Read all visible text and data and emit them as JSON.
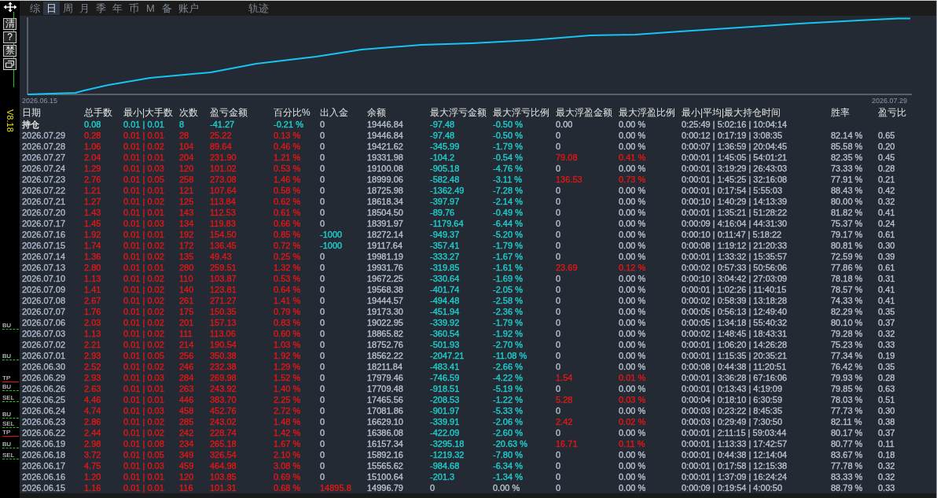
{
  "tabs": [
    {
      "label": "综",
      "selected": false
    },
    {
      "label": "日",
      "selected": true
    },
    {
      "label": "周",
      "selected": false
    },
    {
      "label": "月",
      "selected": false
    },
    {
      "label": "季",
      "selected": false
    },
    {
      "label": "年",
      "selected": false
    },
    {
      "label": "币",
      "selected": false
    },
    {
      "label": "M",
      "selected": false
    },
    {
      "label": "备",
      "selected": false
    },
    {
      "label": "账户",
      "selected": false
    }
  ],
  "track_tab": {
    "label": "轨迹",
    "selected": false
  },
  "toolbar": {
    "buttons": [
      "清",
      "?",
      "禁"
    ],
    "version": "V8.18"
  },
  "chart_markers": [
    {
      "label": "BU",
      "kind": "entry"
    },
    {
      "label": "BU",
      "kind": "entry"
    },
    {
      "label": "TP",
      "kind": "target"
    },
    {
      "label": "BU",
      "kind": "entry"
    },
    {
      "label": "SEL",
      "kind": "entry"
    },
    {
      "label": "BU",
      "kind": "entry"
    },
    {
      "label": "SEL",
      "kind": "entry"
    },
    {
      "label": "TP",
      "kind": "target"
    },
    {
      "label": "BU",
      "kind": "entry"
    },
    {
      "label": "SEL",
      "kind": "entry"
    }
  ],
  "chart": {
    "start_label": "2026.06.15",
    "end_label": "2026.07.29"
  },
  "table": {
    "columns": [
      "日期",
      "总手数",
      "最小|大手数",
      "次数",
      "盈亏金额",
      "百分比%",
      "出入金",
      "余额",
      "最大浮亏金额",
      "最大浮亏比例",
      "最大浮盈金额",
      "最大浮盈比例",
      "最小|平均|最大持仓时间",
      "胜率",
      "盈亏比"
    ],
    "rows": [
      {
        "kind": "holding",
        "date": "持仓",
        "trade": {
          "color": "#1fd0d0",
          "cells": [
            "0.08",
            "0.01 | 0.01",
            "8",
            "-41.27",
            "-0.21 %"
          ]
        },
        "cash": {
          "text": "0"
        },
        "balance": "19446.84",
        "float_loss": {
          "color": "#1fd0d0",
          "cells": [
            "-97.48",
            "-0.50 %"
          ]
        },
        "float_profit": {
          "cells": [
            "0.00",
            "0.00 %"
          ]
        },
        "hold_time": "0:25:49 | 5:02:16 | 10:04:14"
      },
      {
        "kind": "day",
        "date": "2026.07.29",
        "trade": {
          "color": "#e01818",
          "cells": [
            "0.28",
            "0.01 | 0.01",
            "28",
            "25.22",
            "0.13 %"
          ]
        },
        "cash": {
          "text": "0"
        },
        "balance": "19446.84",
        "float_loss": {
          "color": "#1fd0d0",
          "cells": [
            "-97.48",
            "-0.50 %"
          ]
        },
        "float_profit": {
          "cells": [
            "0",
            "0.00 %"
          ]
        },
        "hold_time": "0:00:12 | 0:17:19 | 3:08:35",
        "win_rate": "82.14 %",
        "profit_ratio": "0.65"
      },
      {
        "kind": "day",
        "date": "2026.07.28",
        "trade": {
          "color": "#e01818",
          "cells": [
            "1.06",
            "0.01 | 0.02",
            "104",
            "89.64",
            "0.46 %"
          ]
        },
        "cash": {
          "text": "0"
        },
        "balance": "19421.62",
        "float_loss": {
          "color": "#1fd0d0",
          "cells": [
            "-345.99",
            "-1.79 %"
          ]
        },
        "float_profit": {
          "cells": [
            "0",
            "0.00 %"
          ]
        },
        "hold_time": "0:00:07 | 1:36:59 | 20:04:45",
        "win_rate": "85.58 %",
        "profit_ratio": "0.20"
      },
      {
        "kind": "day",
        "date": "2026.07.27",
        "trade": {
          "color": "#e01818",
          "cells": [
            "2.04",
            "0.01 | 0.01",
            "204",
            "231.90",
            "1.21 %"
          ]
        },
        "cash": {
          "text": "0"
        },
        "balance": "19331.98",
        "float_loss": {
          "color": "#1fd0d0",
          "cells": [
            "-104.2",
            "-0.54 %"
          ]
        },
        "float_profit": {
          "color": "#e01818",
          "cells": [
            "79.08",
            "0.41 %"
          ]
        },
        "hold_time": "0:00:01 | 1:45:05 | 54:01:21",
        "win_rate": "82.35 %",
        "profit_ratio": "0.45"
      },
      {
        "kind": "day",
        "date": "2026.07.24",
        "trade": {
          "color": "#e01818",
          "cells": [
            "1.29",
            "0.01 | 0.03",
            "120",
            "101.02",
            "0.53 %"
          ]
        },
        "cash": {
          "text": "0"
        },
        "balance": "19100.08",
        "float_loss": {
          "color": "#1fd0d0",
          "cells": [
            "-905.18",
            "-4.76 %"
          ]
        },
        "float_profit": {
          "cells": [
            "0",
            "0.00 %"
          ]
        },
        "hold_time": "0:00:01 | 3:19:29 | 26:43:03",
        "win_rate": "73.33 %",
        "profit_ratio": "0.28"
      },
      {
        "kind": "day",
        "date": "2026.07.23",
        "trade": {
          "color": "#e01818",
          "cells": [
            "2.76",
            "0.01 | 0.05",
            "258",
            "273.08",
            "1.46 %"
          ]
        },
        "cash": {
          "text": "0"
        },
        "balance": "18999.06",
        "float_loss": {
          "color": "#1fd0d0",
          "cells": [
            "-582.48",
            "-3.11 %"
          ]
        },
        "float_profit": {
          "color": "#e01818",
          "cells": [
            "136.53",
            "0.73 %"
          ]
        },
        "hold_time": "0:00:01 | 1:45:25 | 32:16:08",
        "win_rate": "77.91 %",
        "profit_ratio": "0.21"
      },
      {
        "kind": "day",
        "date": "2026.07.22",
        "trade": {
          "color": "#e01818",
          "cells": [
            "1.21",
            "0.01 | 0.01",
            "121",
            "107.64",
            "0.58 %"
          ]
        },
        "cash": {
          "text": "0"
        },
        "balance": "18725.98",
        "float_loss": {
          "color": "#1fd0d0",
          "cells": [
            "-1362.49",
            "-7.28 %"
          ]
        },
        "float_profit": {
          "cells": [
            "0",
            "0.00 %"
          ]
        },
        "hold_time": "0:00:01 | 0:17:54 | 5:55:03",
        "win_rate": "88.43 %",
        "profit_ratio": "0.42"
      },
      {
        "kind": "day",
        "date": "2026.07.21",
        "trade": {
          "color": "#e01818",
          "cells": [
            "1.27",
            "0.01 | 0.02",
            "125",
            "113.84",
            "0.62 %"
          ]
        },
        "cash": {
          "text": "0"
        },
        "balance": "18618.34",
        "float_loss": {
          "color": "#1fd0d0",
          "cells": [
            "-397.97",
            "-2.14 %"
          ]
        },
        "float_profit": {
          "cells": [
            "0",
            "0.00 %"
          ]
        },
        "hold_time": "0:00:10 | 1:40:29 | 14:13:39",
        "win_rate": "80.00 %",
        "profit_ratio": "0.32"
      },
      {
        "kind": "day",
        "date": "2026.07.20",
        "trade": {
          "color": "#e01818",
          "cells": [
            "1.43",
            "0.01 | 0.01",
            "143",
            "112.53",
            "0.61 %"
          ]
        },
        "cash": {
          "text": "0"
        },
        "balance": "18504.50",
        "float_loss": {
          "color": "#1fd0d0",
          "cells": [
            "-89.76",
            "-0.49 %"
          ]
        },
        "float_profit": {
          "cells": [
            "0",
            "0.00 %"
          ]
        },
        "hold_time": "0:00:01 | 1:35:21 | 51:28:22",
        "win_rate": "81.82 %",
        "profit_ratio": "0.41"
      },
      {
        "kind": "day",
        "date": "2026.07.17",
        "trade": {
          "color": "#e01818",
          "cells": [
            "1.45",
            "0.01 | 0.03",
            "134",
            "119.83",
            "0.66 %"
          ]
        },
        "cash": {
          "text": "0"
        },
        "balance": "18391.97",
        "float_loss": {
          "color": "#1fd0d0",
          "cells": [
            "-1179.64",
            "-6.44 %"
          ]
        },
        "float_profit": {
          "cells": [
            "0",
            "0.00 %"
          ]
        },
        "hold_time": "0:00:09 | 4:16:04 | 44:31:30",
        "win_rate": "75.37 %",
        "profit_ratio": "0.24"
      },
      {
        "kind": "day",
        "date": "2026.07.16",
        "trade": {
          "color": "#e01818",
          "cells": [
            "1.92",
            "0.01 | 0.01",
            "192",
            "154.50",
            "0.85 %"
          ]
        },
        "cash": {
          "text": "-1000",
          "color": "#1fd0d0"
        },
        "balance": "18272.14",
        "float_loss": {
          "color": "#1fd0d0",
          "cells": [
            "-949.37",
            "-5.20 %"
          ]
        },
        "float_profit": {
          "cells": [
            "0",
            "0.00 %"
          ]
        },
        "hold_time": "0:00:10 | 0:11:47 | 5:18:22",
        "win_rate": "79.17 %",
        "profit_ratio": "0.61"
      },
      {
        "kind": "day",
        "date": "2026.07.15",
        "trade": {
          "color": "#e01818",
          "cells": [
            "1.74",
            "0.01 | 0.02",
            "172",
            "136.45",
            "0.72 %"
          ]
        },
        "cash": {
          "text": "-1000",
          "color": "#1fd0d0"
        },
        "balance": "19117.64",
        "float_loss": {
          "color": "#1fd0d0",
          "cells": [
            "-357.41",
            "-1.79 %"
          ]
        },
        "float_profit": {
          "cells": [
            "0",
            "0.00 %"
          ]
        },
        "hold_time": "0:00:08 | 1:19:12 | 21:20:33",
        "win_rate": "80.81 %",
        "profit_ratio": "0.30"
      },
      {
        "kind": "day",
        "date": "2026.07.14",
        "trade": {
          "color": "#e01818",
          "cells": [
            "1.36",
            "0.01 | 0.02",
            "135",
            "49.43",
            "0.25 %"
          ]
        },
        "cash": {
          "text": "0"
        },
        "balance": "19981.19",
        "float_loss": {
          "color": "#1fd0d0",
          "cells": [
            "-333.27",
            "-1.67 %"
          ]
        },
        "float_profit": {
          "cells": [
            "0",
            "0.00 %"
          ]
        },
        "hold_time": "0:00:01 | 1:33:32 | 15:35:57",
        "win_rate": "72.59 %",
        "profit_ratio": "0.39"
      },
      {
        "kind": "day",
        "date": "2026.07.13",
        "trade": {
          "color": "#e01818",
          "cells": [
            "2.80",
            "0.01 | 0.01",
            "280",
            "259.51",
            "1.32 %"
          ]
        },
        "cash": {
          "text": "0"
        },
        "balance": "19931.76",
        "float_loss": {
          "color": "#1fd0d0",
          "cells": [
            "-319.85",
            "-1.61 %"
          ]
        },
        "float_profit": {
          "color": "#e01818",
          "cells": [
            "23.69",
            "0.12 %"
          ]
        },
        "hold_time": "0:00:02 | 0:57:33 | 50:56:06",
        "win_rate": "77.86 %",
        "profit_ratio": "0.61"
      },
      {
        "kind": "day",
        "date": "2026.07.10",
        "trade": {
          "color": "#e01818",
          "cells": [
            "1.13",
            "0.01 | 0.02",
            "110",
            "103.87",
            "0.53 %"
          ]
        },
        "cash": {
          "text": "0"
        },
        "balance": "19672.25",
        "float_loss": {
          "color": "#1fd0d0",
          "cells": [
            "-330.64",
            "-1.69 %"
          ]
        },
        "float_profit": {
          "cells": [
            "0",
            "0.00 %"
          ]
        },
        "hold_time": "0:00:10 | 3:04:42 | 27:03:09",
        "win_rate": "78.18 %",
        "profit_ratio": "0.31"
      },
      {
        "kind": "day",
        "date": "2026.07.09",
        "trade": {
          "color": "#e01818",
          "cells": [
            "1.41",
            "0.01 | 0.02",
            "140",
            "123.81",
            "0.64 %"
          ]
        },
        "cash": {
          "text": "0"
        },
        "balance": "19568.38",
        "float_loss": {
          "color": "#1fd0d0",
          "cells": [
            "-401.74",
            "-2.05 %"
          ]
        },
        "float_profit": {
          "cells": [
            "0",
            "0.00 %"
          ]
        },
        "hold_time": "0:00:01 | 1:02:26 | 11:40:15",
        "win_rate": "78.57 %",
        "profit_ratio": "0.41"
      },
      {
        "kind": "day",
        "date": "2026.07.08",
        "trade": {
          "color": "#e01818",
          "cells": [
            "2.67",
            "0.01 | 0.02",
            "261",
            "271.27",
            "1.41 %"
          ]
        },
        "cash": {
          "text": "0"
        },
        "balance": "19444.57",
        "float_loss": {
          "color": "#1fd0d0",
          "cells": [
            "-494.48",
            "-2.58 %"
          ]
        },
        "float_profit": {
          "cells": [
            "0",
            "0.00 %"
          ]
        },
        "hold_time": "0:00:02 | 0:58:39 | 13:18:28",
        "win_rate": "74.33 %",
        "profit_ratio": "0.41"
      },
      {
        "kind": "day",
        "date": "2026.07.07",
        "trade": {
          "color": "#e01818",
          "cells": [
            "1.76",
            "0.01 | 0.02",
            "175",
            "150.35",
            "0.79 %"
          ]
        },
        "cash": {
          "text": "0"
        },
        "balance": "19173.30",
        "float_loss": {
          "color": "#1fd0d0",
          "cells": [
            "-451.94",
            "-2.36 %"
          ]
        },
        "float_profit": {
          "cells": [
            "0",
            "0.00 %"
          ]
        },
        "hold_time": "0:00:05 | 0:56:13 | 12:49:40",
        "win_rate": "82.29 %",
        "profit_ratio": "0.35"
      },
      {
        "kind": "day",
        "date": "2026.07.06",
        "trade": {
          "color": "#e01818",
          "cells": [
            "2.03",
            "0.01 | 0.02",
            "201",
            "157.13",
            "0.83 %"
          ]
        },
        "cash": {
          "text": "0"
        },
        "balance": "19022.95",
        "float_loss": {
          "color": "#1fd0d0",
          "cells": [
            "-339.92",
            "-1.79 %"
          ]
        },
        "float_profit": {
          "cells": [
            "0",
            "0.00 %"
          ]
        },
        "hold_time": "0:00:05 | 1:34:18 | 55:40:32",
        "win_rate": "80.10 %",
        "profit_ratio": "0.37"
      },
      {
        "kind": "day",
        "date": "2026.07.03",
        "trade": {
          "color": "#e01818",
          "cells": [
            "1.13",
            "0.01 | 0.02",
            "111",
            "113.06",
            "0.60 %"
          ]
        },
        "cash": {
          "text": "0"
        },
        "balance": "18865.82",
        "float_loss": {
          "color": "#1fd0d0",
          "cells": [
            "-360.54",
            "-1.92 %"
          ]
        },
        "float_profit": {
          "cells": [
            "0",
            "0.00 %"
          ]
        },
        "hold_time": "0:00:02 | 1:48:45 | 18:43:31",
        "win_rate": "79.28 %",
        "profit_ratio": "0.32"
      },
      {
        "kind": "day",
        "date": "2026.07.02",
        "trade": {
          "color": "#e01818",
          "cells": [
            "2.21",
            "0.01 | 0.02",
            "214",
            "190.54",
            "1.03 %"
          ]
        },
        "cash": {
          "text": "0"
        },
        "balance": "18752.76",
        "float_loss": {
          "color": "#1fd0d0",
          "cells": [
            "-501.93",
            "-2.70 %"
          ]
        },
        "float_profit": {
          "cells": [
            "0",
            "0.00 %"
          ]
        },
        "hold_time": "0:00:01 | 1:06:20 | 14:26:28",
        "win_rate": "75.23 %",
        "profit_ratio": "0.33"
      },
      {
        "kind": "day",
        "date": "2026.07.01",
        "trade": {
          "color": "#e01818",
          "cells": [
            "2.93",
            "0.01 | 0.05",
            "256",
            "350.38",
            "1.92 %"
          ]
        },
        "cash": {
          "text": "0"
        },
        "balance": "18562.22",
        "float_loss": {
          "color": "#1fd0d0",
          "cells": [
            "-2047.21",
            "-11.08 %"
          ]
        },
        "float_profit": {
          "cells": [
            "0",
            "0.00 %"
          ]
        },
        "hold_time": "0:00:01 | 1:15:35 | 20:35:21",
        "win_rate": "77.34 %",
        "profit_ratio": "0.19"
      },
      {
        "kind": "day",
        "date": "2026.06.30",
        "trade": {
          "color": "#e01818",
          "cells": [
            "2.52",
            "0.01 | 0.02",
            "246",
            "232.38",
            "1.29 %"
          ]
        },
        "cash": {
          "text": "0"
        },
        "balance": "18211.84",
        "float_loss": {
          "color": "#1fd0d0",
          "cells": [
            "-483.41",
            "-2.66 %"
          ]
        },
        "float_profit": {
          "cells": [
            "0",
            "0.00 %"
          ]
        },
        "hold_time": "0:00:08 | 0:44:38 | 11:20:51",
        "win_rate": "76.42 %",
        "profit_ratio": "0.35"
      },
      {
        "kind": "day",
        "date": "2026.06.29",
        "trade": {
          "color": "#e01818",
          "cells": [
            "2.93",
            "0.01 | 0.03",
            "284",
            "269.98",
            "1.52 %"
          ]
        },
        "cash": {
          "text": "0"
        },
        "balance": "17979.46",
        "float_loss": {
          "color": "#1fd0d0",
          "cells": [
            "-746.59",
            "-4.22 %"
          ]
        },
        "float_profit": {
          "color": "#e01818",
          "cells": [
            "1.54",
            "0.01 %"
          ]
        },
        "hold_time": "0:00:01 | 3:36:28 | 67:16:06",
        "win_rate": "79.93 %",
        "profit_ratio": "0.28"
      },
      {
        "kind": "day",
        "date": "2026.06.26",
        "trade": {
          "color": "#e01818",
          "cells": [
            "2.63",
            "0.01 | 0.01",
            "263",
            "243.92",
            "1.40 %"
          ]
        },
        "cash": {
          "text": "0"
        },
        "balance": "17709.48",
        "float_loss": {
          "color": "#1fd0d0",
          "cells": [
            "-918.51",
            "-5.19 %"
          ]
        },
        "float_profit": {
          "cells": [
            "0",
            "0.00 %"
          ]
        },
        "hold_time": "0:00:01 | 0:13:43 | 4:19:09",
        "win_rate": "79.85 %",
        "profit_ratio": "0.63"
      },
      {
        "kind": "day",
        "date": "2026.06.25",
        "trade": {
          "color": "#e01818",
          "cells": [
            "4.46",
            "0.01 | 0.01",
            "446",
            "383.70",
            "2.25 %"
          ]
        },
        "cash": {
          "text": "0"
        },
        "balance": "17465.56",
        "float_loss": {
          "color": "#1fd0d0",
          "cells": [
            "-208.53",
            "-1.22 %"
          ]
        },
        "float_profit": {
          "color": "#e01818",
          "cells": [
            "5.28",
            "0.03 %"
          ]
        },
        "hold_time": "0:00:04 | 0:18:10 | 6:30:59",
        "win_rate": "78.03 %",
        "profit_ratio": "0.51"
      },
      {
        "kind": "day",
        "date": "2026.06.24",
        "trade": {
          "color": "#e01818",
          "cells": [
            "4.74",
            "0.01 | 0.03",
            "458",
            "452.76",
            "2.72 %"
          ]
        },
        "cash": {
          "text": "0"
        },
        "balance": "17081.86",
        "float_loss": {
          "color": "#1fd0d0",
          "cells": [
            "-901.97",
            "-5.33 %"
          ]
        },
        "float_profit": {
          "cells": [
            "0",
            "0.00 %"
          ]
        },
        "hold_time": "0:00:03 | 0:23:22 | 8:45:35",
        "win_rate": "77.73 %",
        "profit_ratio": "0.30"
      },
      {
        "kind": "day",
        "date": "2026.06.23",
        "trade": {
          "color": "#e01818",
          "cells": [
            "2.86",
            "0.01 | 0.02",
            "285",
            "243.02",
            "1.48 %"
          ]
        },
        "cash": {
          "text": "0"
        },
        "balance": "16629.10",
        "float_loss": {
          "color": "#1fd0d0",
          "cells": [
            "-339.91",
            "-2.06 %"
          ]
        },
        "float_profit": {
          "color": "#e01818",
          "cells": [
            "2.42",
            "0.02 %"
          ]
        },
        "hold_time": "0:00:03 | 0:29:49 | 7:30:50",
        "win_rate": "82.11 %",
        "profit_ratio": "0.38"
      },
      {
        "kind": "day",
        "date": "2026.06.22",
        "trade": {
          "color": "#e01818",
          "cells": [
            "2.44",
            "0.01 | 0.02",
            "242",
            "228.74",
            "1.42 %"
          ]
        },
        "cash": {
          "text": "0"
        },
        "balance": "16386.08",
        "float_loss": {
          "color": "#1fd0d0",
          "cells": [
            "-422.09",
            "-2.60 %"
          ]
        },
        "float_profit": {
          "cells": [
            "0",
            "0.00 %"
          ]
        },
        "hold_time": "0:00:01 | 2:11:15 | 59:03:44",
        "win_rate": "80.17 %",
        "profit_ratio": "0.37"
      },
      {
        "kind": "day",
        "date": "2026.06.19",
        "trade": {
          "color": "#e01818",
          "cells": [
            "2.98",
            "0.01 | 0.08",
            "234",
            "265.18",
            "1.67 %"
          ]
        },
        "cash": {
          "text": "0"
        },
        "balance": "16157.34",
        "float_loss": {
          "color": "#1fd0d0",
          "cells": [
            "-3295.18",
            "-20.63 %"
          ]
        },
        "float_profit": {
          "color": "#e01818",
          "cells": [
            "16.71",
            "0.11 %"
          ]
        },
        "hold_time": "0:00:01 | 1:13:33 | 17:42:57",
        "win_rate": "80.77 %",
        "profit_ratio": "0.11"
      },
      {
        "kind": "day",
        "date": "2026.06.18",
        "trade": {
          "color": "#e01818",
          "cells": [
            "3.72",
            "0.01 | 0.05",
            "349",
            "326.54",
            "2.10 %"
          ]
        },
        "cash": {
          "text": "0"
        },
        "balance": "15892.16",
        "float_loss": {
          "color": "#1fd0d0",
          "cells": [
            "-1219.32",
            "-7.80 %"
          ]
        },
        "float_profit": {
          "cells": [
            "0",
            "0.00 %"
          ]
        },
        "hold_time": "0:00:01 | 0:44:38 | 12:14:04",
        "win_rate": "83.67 %",
        "profit_ratio": "0.18"
      },
      {
        "kind": "day",
        "date": "2026.06.17",
        "trade": {
          "color": "#e01818",
          "cells": [
            "4.75",
            "0.01 | 0.03",
            "459",
            "464.98",
            "3.08 %"
          ]
        },
        "cash": {
          "text": "0"
        },
        "balance": "15565.62",
        "float_loss": {
          "color": "#1fd0d0",
          "cells": [
            "-984.68",
            "-6.34 %"
          ]
        },
        "float_profit": {
          "cells": [
            "0",
            "0.00 %"
          ]
        },
        "hold_time": "0:00:01 | 0:17:58 | 12:15:38",
        "win_rate": "77.78 %",
        "profit_ratio": "0.32"
      },
      {
        "kind": "day",
        "date": "2026.06.16",
        "trade": {
          "color": "#e01818",
          "cells": [
            "1.20",
            "0.01 | 0.01",
            "120",
            "103.85",
            "0.69 %"
          ]
        },
        "cash": {
          "text": "0"
        },
        "balance": "15100.64",
        "float_loss": {
          "color": "#1fd0d0",
          "cells": [
            "-201.3",
            "-1.34 %"
          ]
        },
        "float_profit": {
          "cells": [
            "0",
            "0.00 %"
          ]
        },
        "hold_time": "0:00:01 | 1:37:09 | 16:24:24",
        "win_rate": "83.33 %",
        "profit_ratio": "0.32"
      },
      {
        "kind": "day",
        "date": "2026.06.15",
        "trade": {
          "color": "#e01818",
          "cells": [
            "1.16",
            "0.01 | 0.01",
            "116",
            "101.31",
            "0.68 %"
          ]
        },
        "cash": {
          "text": "14895.8",
          "color": "#e01818"
        },
        "balance": "14996.79",
        "float_loss": {
          "cells": [
            "0",
            "0.00 %"
          ]
        },
        "float_profit": {
          "cells": [
            "0",
            "0.00 %"
          ]
        },
        "hold_time": "0:00:09 | 0:19:54 | 4:00:50",
        "win_rate": "88.79 %",
        "profit_ratio": "0.33"
      }
    ]
  }
}
